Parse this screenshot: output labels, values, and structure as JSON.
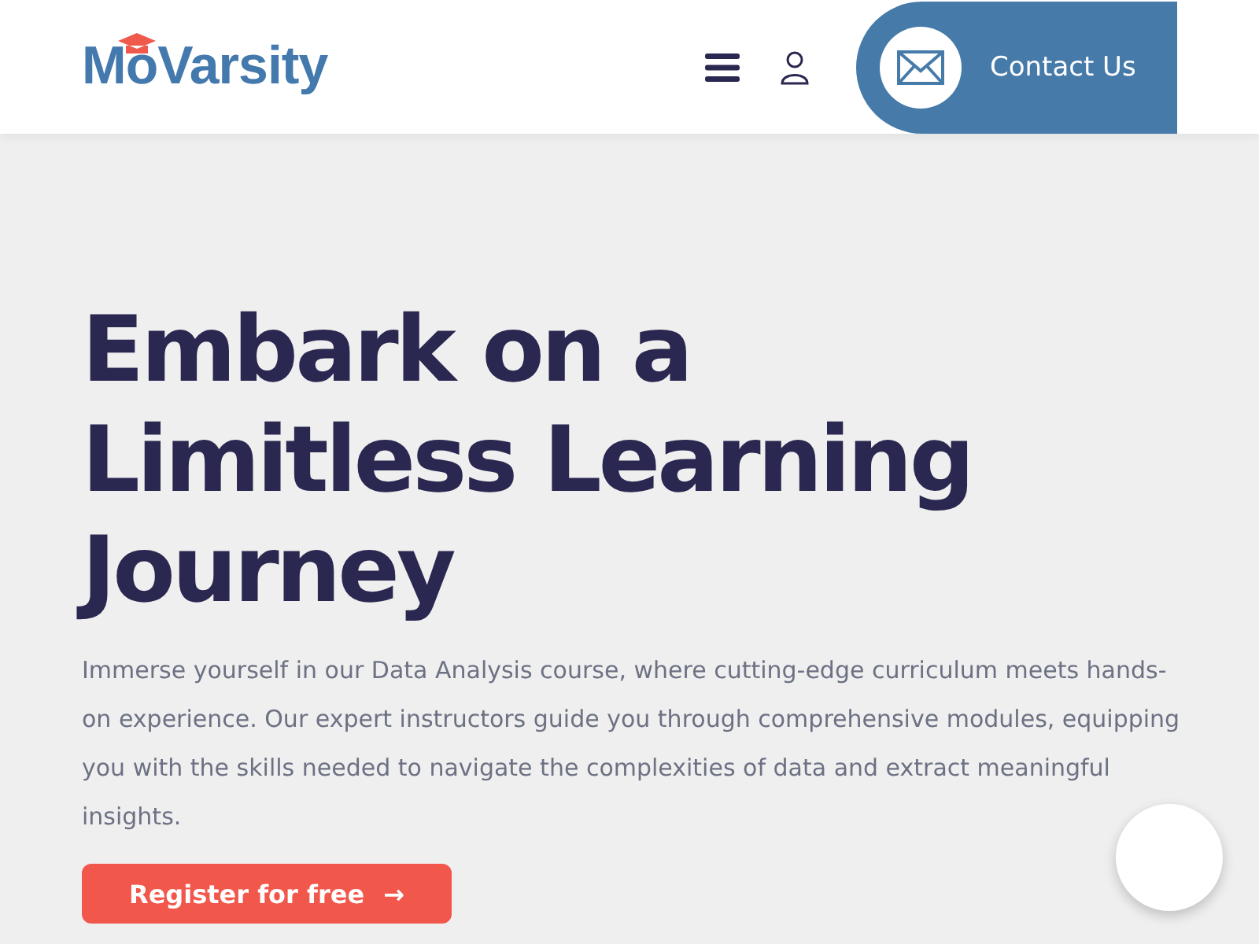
{
  "header": {
    "logo": "MoVarsity",
    "contact": {
      "label": "Contact Us"
    }
  },
  "hero": {
    "title_lines": [
      "Embark on a",
      "Limitless Learning",
      "Journey"
    ],
    "description": "Immerse yourself in our Data Analysis course, where cutting-edge curriculum meets hands-on experience. Our expert instructors guide you through comprehensive modules, equipping you with the skills needed to navigate the complexities of data and extract meaningful insights.",
    "cta": {
      "label": "Register for free",
      "arrow": "→"
    }
  }
}
